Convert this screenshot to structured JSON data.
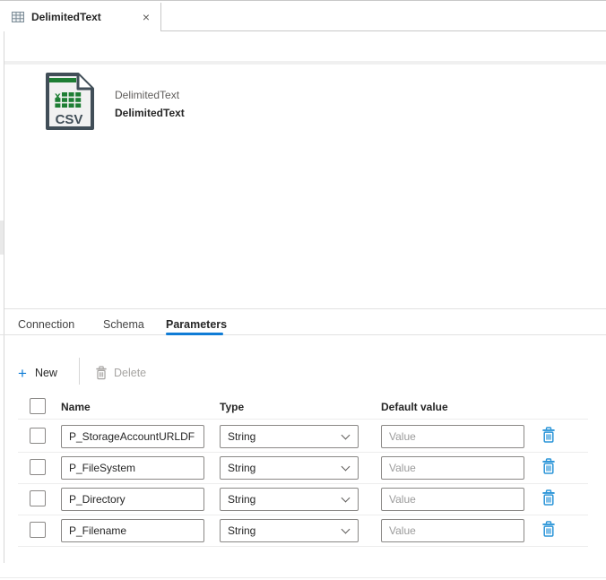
{
  "tab_bar": {
    "active_tab": {
      "label": "DelimitedText",
      "icon": "table-grid-icon"
    }
  },
  "icons": {
    "close": "×",
    "plus": "+"
  },
  "dataset_header": {
    "icon_name": "csv-file-icon",
    "file_type_label": "CSV",
    "type_caption": "DelimitedText",
    "name": "DelimitedText"
  },
  "properties_panel": {
    "tabs": [
      {
        "label": "Connection",
        "active": false
      },
      {
        "label": "Schema",
        "active": false
      },
      {
        "label": "Parameters",
        "active": true
      }
    ],
    "toolbar": {
      "new_label": "New",
      "delete_label": "Delete",
      "delete_disabled": true
    },
    "table": {
      "columns": [
        "Name",
        "Type",
        "Default value"
      ],
      "value_placeholder": "Value",
      "rows": [
        {
          "name": "P_StorageAccountURLDF",
          "type": "String"
        },
        {
          "name": "P_FileSystem",
          "type": "String"
        },
        {
          "name": "P_Directory",
          "type": "String"
        },
        {
          "name": "P_Filename",
          "type": "String"
        }
      ]
    }
  },
  "colors": {
    "accent_blue": "#0f7cd6",
    "icon_green": "#1e7e34",
    "icon_slate": "#414e58",
    "trash_blue": "#2b95d8",
    "disabled_gray": "#a6a4a2"
  }
}
